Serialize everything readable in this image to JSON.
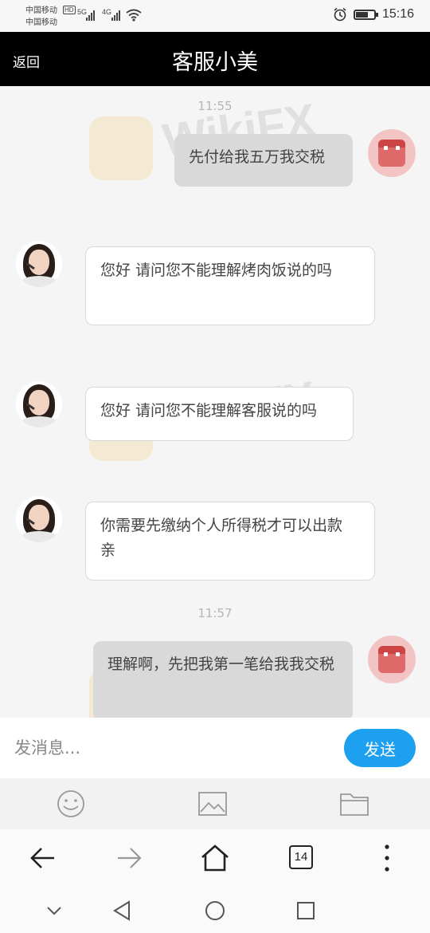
{
  "status_bar": {
    "carrier_1": "中国移动",
    "carrier_2": "中国移动",
    "hd_badge": "HD",
    "network_1": "5G",
    "network_2": "4G",
    "time": "15:16"
  },
  "header": {
    "back_label": "返回",
    "title": "客服小美"
  },
  "messages": [
    {
      "type": "time",
      "text": "11:55"
    },
    {
      "from": "user",
      "text": "先付给我五万我交税"
    },
    {
      "from": "agent",
      "text": "您好   请问您不能理解烤肉饭说的吗"
    },
    {
      "from": "agent",
      "text": "您好 请问您不能理解客服说的吗"
    },
    {
      "from": "agent",
      "text": "你需要先缴纳个人所得税才可以出款   亲"
    },
    {
      "type": "time",
      "text": "11:57"
    },
    {
      "from": "user",
      "text": "理解啊，先把我第一笔给我我交税"
    }
  ],
  "input": {
    "placeholder": "发消息...",
    "send_label": "发送"
  },
  "toolbar": {
    "items": [
      "emoji-icon",
      "image-icon",
      "folder-icon"
    ]
  },
  "browser": {
    "tab_count": "14"
  },
  "watermark": {
    "text": "WikiFX"
  },
  "colors": {
    "header_bg": "#000000",
    "send_button": "#1ea0f0",
    "user_bubble": "#d9d9d9",
    "agent_bubble": "#ffffff",
    "user_avatar": "#e06a6a"
  }
}
